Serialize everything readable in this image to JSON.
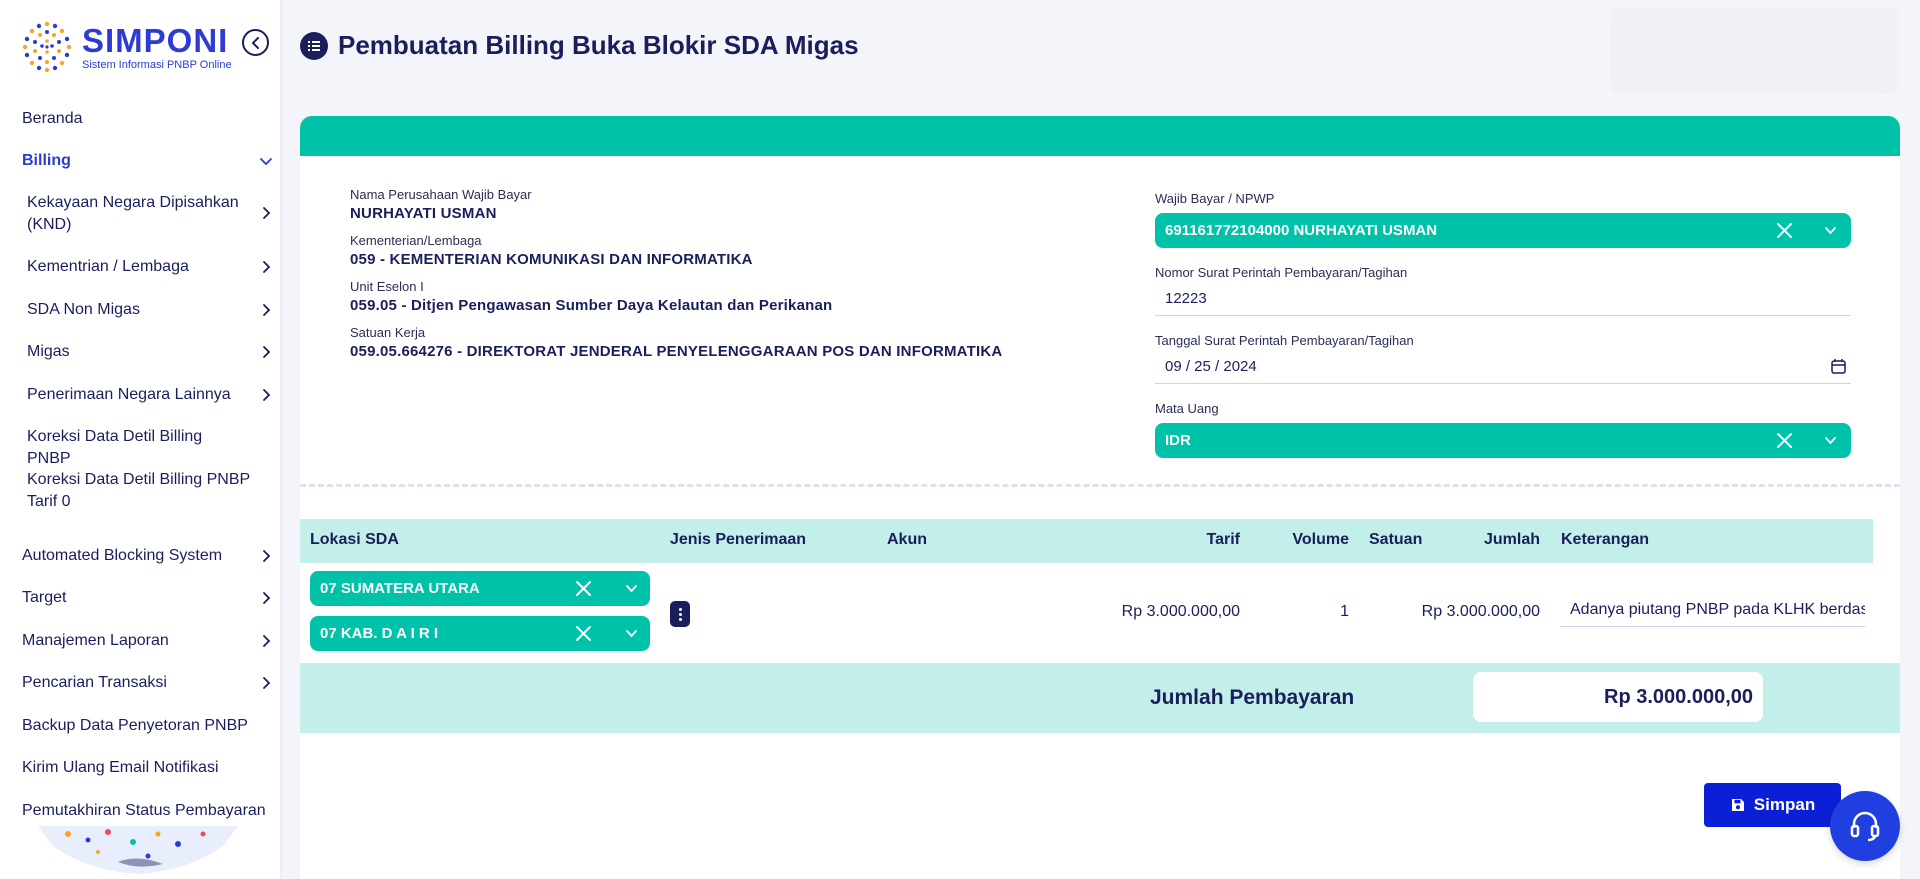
{
  "app": {
    "logo_title": "SIMPONI",
    "logo_subtitle": "Sistem Informasi PNBP Online"
  },
  "sidebar": {
    "items": [
      {
        "label": "Beranda",
        "level": "top",
        "chevron": "none"
      },
      {
        "label": "Billing",
        "level": "top",
        "chevron": "down",
        "active": true
      },
      {
        "label": "Kekayaan Negara Dipisahkan (KND)",
        "level": "sub",
        "chevron": "right"
      },
      {
        "label": "Kementrian / Lembaga",
        "level": "sub",
        "chevron": "right"
      },
      {
        "label": "SDA Non Migas",
        "level": "sub",
        "chevron": "right"
      },
      {
        "label": "Migas",
        "level": "sub",
        "chevron": "right"
      },
      {
        "label": "Penerimaan Negara Lainnya",
        "level": "sub",
        "chevron": "right"
      },
      {
        "label": "Koreksi Data Detil Billing PNBP",
        "level": "sub",
        "chevron": "none"
      },
      {
        "label": "Koreksi Data Detil Billing PNBP Tarif 0",
        "level": "sub",
        "chevron": "none"
      },
      {
        "label": "Automated Blocking System",
        "level": "top",
        "chevron": "right"
      },
      {
        "label": "Target",
        "level": "top",
        "chevron": "right"
      },
      {
        "label": "Manajemen Laporan",
        "level": "top",
        "chevron": "right"
      },
      {
        "label": "Pencarian Transaksi",
        "level": "top",
        "chevron": "right"
      },
      {
        "label": "Backup Data Penyetoran PNBP",
        "level": "top",
        "chevron": "none"
      },
      {
        "label": "Kirim Ulang Email Notifikasi",
        "level": "top",
        "chevron": "none"
      },
      {
        "label": "Pemutakhiran Status Pembayaran",
        "level": "top",
        "chevron": "none"
      }
    ]
  },
  "header": {
    "title": "Pembuatan Billing Buka Blokir SDA Migas"
  },
  "info": {
    "company_label": "Nama Perusahaan Wajib Bayar",
    "company_value": "NURHAYATI USMAN",
    "ministry_label": "Kementerian/Lembaga",
    "ministry_value": "059 - KEMENTERIAN KOMUNIKASI DAN INFORMATIKA",
    "eselon_label": "Unit Eselon I",
    "eselon_value": "059.05 - Ditjen Pengawasan Sumber Daya Kelautan dan Perikanan",
    "satker_label": "Satuan Kerja",
    "satker_value": "059.05.664276 - DIREKTORAT JENDERAL PENYELENGGARAAN POS DAN INFORMATIKA"
  },
  "form": {
    "npwp_label": "Wajib Bayar / NPWP",
    "npwp_value": "691161772104000 NURHAYATI USMAN",
    "nomor_label": "Nomor Surat Perintah Pembayaran/Tagihan",
    "nomor_value": "12223",
    "tanggal_label": "Tanggal Surat Perintah Pembayaran/Tagihan",
    "tanggal_value": "09 / 25 / 2024",
    "mata_uang_label": "Mata Uang",
    "mata_uang_value": "IDR"
  },
  "table": {
    "headers": {
      "lokasi": "Lokasi SDA",
      "jenis": "Jenis Penerimaan",
      "akun": "Akun",
      "tarif": "Tarif",
      "volume": "Volume",
      "satuan": "Satuan",
      "jumlah": "Jumlah",
      "keterangan": "Keterangan"
    },
    "row": {
      "provinsi": "07 SUMATERA UTARA",
      "kabupaten": "07 KAB. D A I R I",
      "tarif": "Rp 3.000.000,00",
      "volume": "1",
      "jumlah": "Rp 3.000.000,00",
      "keterangan": "Adanya piutang PNBP pada KLHK  berdasar"
    }
  },
  "total": {
    "label": "Jumlah Pembayaran",
    "value": "Rp 3.000.000,00"
  },
  "actions": {
    "save_label": "Simpan"
  },
  "colors": {
    "primary_teal": "#00c2a8",
    "light_teal": "#c2efe9",
    "navy": "#1a1f5c",
    "brand_blue": "#2e3bd1",
    "button_blue": "#0a1fd6"
  }
}
